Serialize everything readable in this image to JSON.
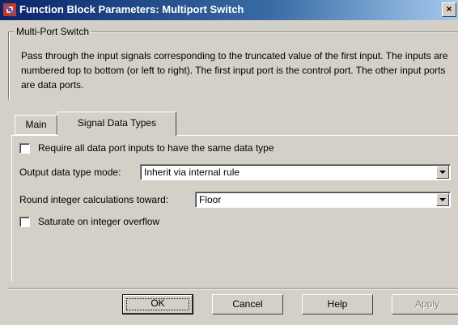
{
  "window": {
    "title": "Function Block Parameters: Multiport Switch",
    "close_symbol": "×",
    "colors": {
      "titlebar_start": "#0a246a",
      "titlebar_end": "#a6caf0",
      "face": "#d4d0c8"
    }
  },
  "group": {
    "legend": "Multi-Port Switch",
    "description": "Pass through the input signals corresponding to the truncated value of the first input. The inputs are numbered top to bottom (or left to right). The first input port is the control port. The other input ports are data ports."
  },
  "tabs": [
    {
      "label": "Main",
      "selected": false
    },
    {
      "label": "Signal Data Types",
      "selected": true
    }
  ],
  "panel": {
    "require_same_type": {
      "label": "Require all data port inputs to have the same data type",
      "checked": false
    },
    "output_mode": {
      "label": "Output data type mode:",
      "value": "Inherit via internal rule"
    },
    "rounding": {
      "label": "Round integer calculations toward:",
      "value": "Floor"
    },
    "saturate": {
      "label": "Saturate on integer overflow",
      "checked": false
    }
  },
  "buttons": {
    "ok": "OK",
    "cancel": "Cancel",
    "help": "Help",
    "apply": "Apply"
  },
  "icons": {
    "app": "simulink-block-icon",
    "close": "close-icon",
    "dropdown": "chevron-down-icon"
  }
}
